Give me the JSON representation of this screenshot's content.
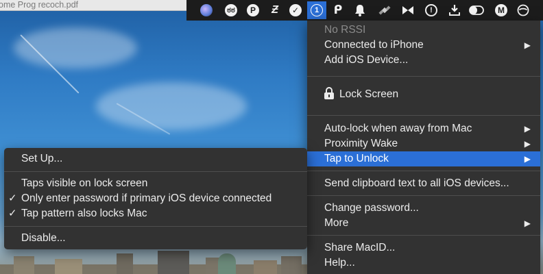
{
  "window": {
    "title_fragment": "ome Prog   recoch.pdf"
  },
  "menubar": {
    "icons": [
      {
        "name": "siri-icon",
        "glyph": "◐"
      },
      {
        "name": "owl-icon",
        "glyph": "ಠ"
      },
      {
        "name": "p-circle-icon",
        "glyph": "P"
      },
      {
        "name": "z-script-icon",
        "glyph": "Z"
      },
      {
        "name": "checkmark-circle-icon",
        "glyph": "✓"
      },
      {
        "name": "macid-icon",
        "glyph": "1"
      },
      {
        "name": "p-script-icon",
        "glyph": "P"
      },
      {
        "name": "bell-icon",
        "glyph": "🔔"
      },
      {
        "name": "satellite-icon",
        "glyph": "⌁"
      },
      {
        "name": "bowtie-icon",
        "glyph": "✕"
      },
      {
        "name": "info-circle-icon",
        "glyph": "!"
      },
      {
        "name": "download-icon",
        "glyph": "⇩"
      },
      {
        "name": "toggle-icon",
        "glyph": ""
      },
      {
        "name": "m-circle-icon",
        "glyph": "M"
      },
      {
        "name": "no-entry-icon",
        "glyph": "⊘"
      }
    ]
  },
  "main_menu": {
    "no_rssi": "No RSSI",
    "connected_to_iphone": "Connected to iPhone",
    "add_ios_device": "Add iOS Device...",
    "lock_screen": "Lock Screen",
    "auto_lock": "Auto-lock when away from Mac",
    "proximity_wake": "Proximity Wake",
    "tap_to_unlock": "Tap to Unlock",
    "send_clipboard": "Send clipboard text to all iOS devices...",
    "change_password": "Change password...",
    "more": "More",
    "share_macid": "Share MacID...",
    "help": "Help...",
    "submenu_arrow": "▶"
  },
  "sub_menu": {
    "set_up": "Set Up...",
    "taps_visible": "Taps visible on lock screen",
    "only_enter_password": "Only enter password if primary iOS device connected",
    "tap_pattern_locks": "Tap pattern also locks Mac",
    "disable": "Disable...",
    "checkmark": "✓"
  },
  "colors": {
    "menu_bg": "#323232",
    "highlight": "#2b6fd6",
    "menubar_bg": "#1c1c1c"
  }
}
